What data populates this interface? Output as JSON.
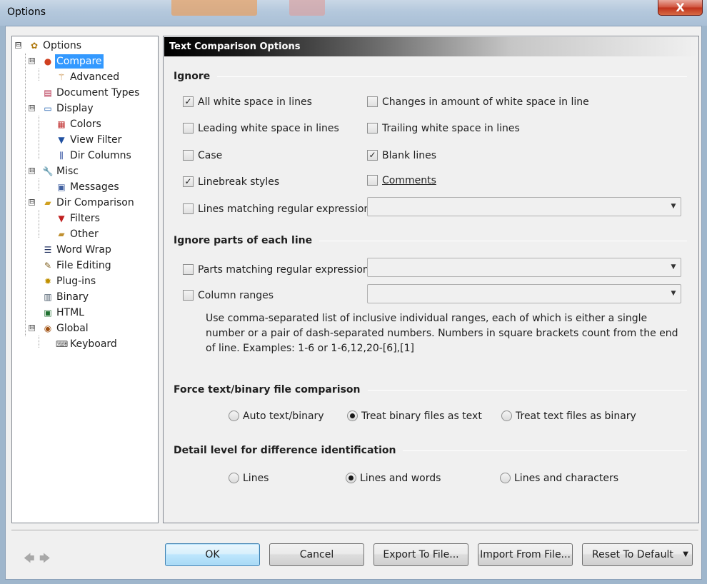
{
  "window": {
    "title": "Options",
    "close_glyph": "X"
  },
  "tree": {
    "items": [
      {
        "label": "Options",
        "icon": "gear-icon"
      },
      {
        "label": "Compare",
        "icon": "compare-icon"
      },
      {
        "label": "Advanced",
        "icon": "wand-icon"
      },
      {
        "label": "Document Types",
        "icon": "document-types-icon"
      },
      {
        "label": "Display",
        "icon": "monitor-icon"
      },
      {
        "label": "Colors",
        "icon": "color-grid-icon"
      },
      {
        "label": "View Filter",
        "icon": "funnel-icon"
      },
      {
        "label": "Dir Columns",
        "icon": "columns-icon"
      },
      {
        "label": "Misc",
        "icon": "wrench-icon"
      },
      {
        "label": "Messages",
        "icon": "messages-icon"
      },
      {
        "label": "Dir Comparison",
        "icon": "folders-icon"
      },
      {
        "label": "Filters",
        "icon": "red-funnel-icon"
      },
      {
        "label": "Other",
        "icon": "folder-icon"
      },
      {
        "label": "Word Wrap",
        "icon": "word-wrap-icon"
      },
      {
        "label": "File Editing",
        "icon": "pencil-icon"
      },
      {
        "label": "Plug-ins",
        "icon": "plugin-icon"
      },
      {
        "label": "Binary",
        "icon": "binary-icon"
      },
      {
        "label": "HTML",
        "icon": "html-icon"
      },
      {
        "label": "Global",
        "icon": "global-icon"
      },
      {
        "label": "Keyboard",
        "icon": "keyboard-icon"
      }
    ],
    "expanders": [
      "⊟",
      "⊟",
      "⊟",
      "⊟",
      "⊟",
      "⊟"
    ]
  },
  "panel": {
    "header": "Text Comparison Options",
    "ignore": {
      "title": "Ignore",
      "options": {
        "all_white_space": {
          "label": "All white space in lines",
          "checked": true,
          "mark": "✓"
        },
        "amount_white_space": {
          "label": "Changes in amount of white space in line",
          "checked": false,
          "mark": ""
        },
        "leading_white_space": {
          "label": "Leading white space in lines",
          "checked": false,
          "mark": ""
        },
        "trailing_white_space": {
          "label": "Trailing white space in lines",
          "checked": false,
          "mark": ""
        },
        "case": {
          "label": "Case",
          "checked": false,
          "mark": ""
        },
        "blank_lines": {
          "label": "Blank lines",
          "checked": true,
          "mark": "✓"
        },
        "linebreak_styles": {
          "label": "Linebreak styles",
          "checked": true,
          "mark": "✓"
        },
        "comments": {
          "label": "Comments",
          "checked": false,
          "mark": ""
        },
        "lines_matching_regex": {
          "label": "Lines matching regular expression",
          "checked": false,
          "mark": ""
        }
      },
      "regex_value": ""
    },
    "ignore_parts": {
      "title": "Ignore parts of each line",
      "parts_regex": {
        "label": "Parts matching regular expression",
        "checked": false,
        "mark": "",
        "value": ""
      },
      "column_ranges": {
        "label": "Column ranges",
        "checked": false,
        "mark": "",
        "value": ""
      },
      "help": "Use comma-separated list of inclusive individual ranges, each of which is either a single number or a pair of dash-separated numbers. Numbers in square brackets count from the end of line. Examples: 1-6 or 1-6,12,20-[6],[1]"
    },
    "force": {
      "title": "Force text/binary file comparison",
      "options": [
        {
          "label": "Auto text/binary",
          "selected": false
        },
        {
          "label": "Treat binary files as text",
          "selected": true
        },
        {
          "label": "Treat text files as binary",
          "selected": false
        }
      ]
    },
    "detail": {
      "title": "Detail level for difference identification",
      "options": [
        {
          "label": "Lines",
          "selected": false
        },
        {
          "label": "Lines and words",
          "selected": true
        },
        {
          "label": "Lines and characters",
          "selected": false
        }
      ]
    }
  },
  "buttons": {
    "ok": "OK",
    "cancel": "Cancel",
    "export": "Export To File...",
    "import": "Import From File...",
    "reset": "Reset To Default",
    "reset_dropdown": "▼",
    "back": "🡄",
    "forward": "🡆"
  },
  "colors": {
    "selection": "#3399ff",
    "close_button": "#c7402b"
  }
}
